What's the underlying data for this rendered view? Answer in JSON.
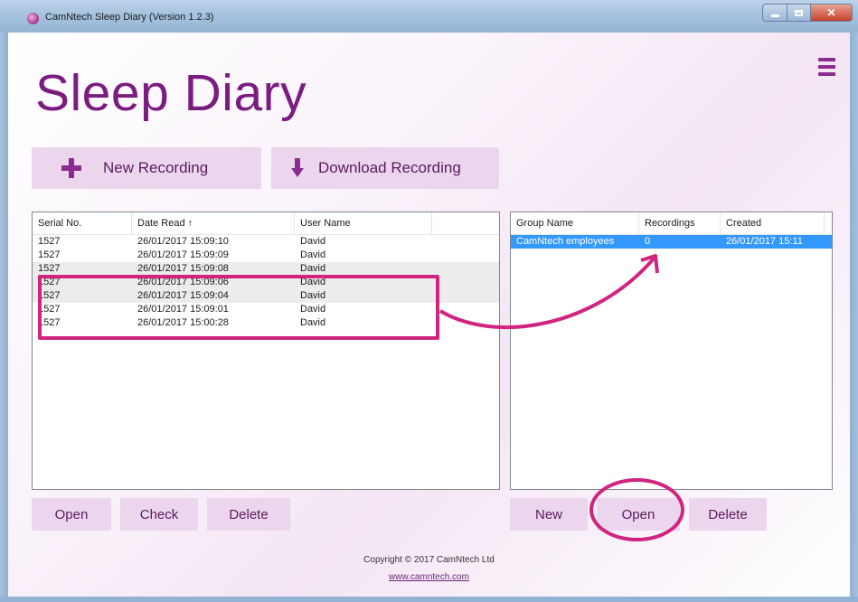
{
  "window": {
    "title": "CamNtech Sleep Diary (Version 1.2.3)"
  },
  "app": {
    "heading": "Sleep Diary",
    "menu_icon": "hamburger-menu-icon",
    "accent_color": "#7b1d80",
    "button_bg": "#ecd6ee"
  },
  "toolbar": {
    "new_recording": "New Recording",
    "download_recording": "Download Recording"
  },
  "recordings": {
    "columns": [
      "Serial No.",
      "Date Read  ↑",
      "User Name"
    ],
    "rows": [
      {
        "serial": "1527",
        "date": "26/01/2017 15:09:10",
        "user": "David"
      },
      {
        "serial": "1527",
        "date": "26/01/2017 15:09:09",
        "user": "David"
      },
      {
        "serial": "1527",
        "date": "26/01/2017 15:09:08",
        "user": "David"
      },
      {
        "serial": "1527",
        "date": "26/01/2017 15:09:06",
        "user": "David"
      },
      {
        "serial": "1527",
        "date": "26/01/2017 15:09:04",
        "user": "David"
      },
      {
        "serial": "1527",
        "date": "26/01/2017 15:09:01",
        "user": "David"
      },
      {
        "serial": "1527",
        "date": "26/01/2017 15:00:28",
        "user": "David"
      }
    ],
    "open_label": "Open",
    "check_label": "Check",
    "delete_label": "Delete"
  },
  "groups": {
    "columns": [
      "Group Name",
      "Recordings",
      "Created"
    ],
    "rows": [
      {
        "name": "CamNtech employees",
        "recordings": "0",
        "created": "26/01/2017 15:11"
      }
    ],
    "new_label": "New",
    "open_label": "Open",
    "delete_label": "Delete"
  },
  "footer": {
    "copyright": "Copyright © 2017 CamNtech Ltd",
    "website": "www.camntech.com"
  },
  "annotation_color": "#d0247f"
}
